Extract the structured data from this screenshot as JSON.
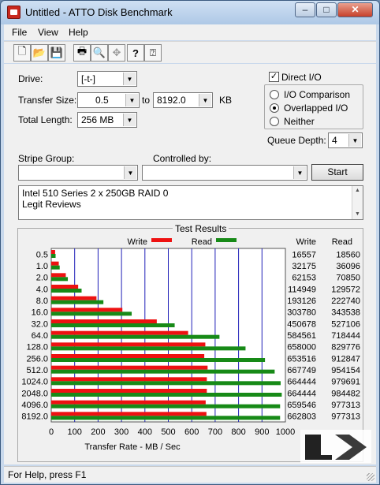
{
  "window": {
    "title": "Untitled - ATTO Disk Benchmark"
  },
  "window_controls": {
    "minimize": "–",
    "maximize": "□",
    "close": "✕"
  },
  "menu": [
    "File",
    "View",
    "Help"
  ],
  "toolbar": {
    "icons": [
      "new-file-icon",
      "open-folder-icon",
      "save-disk-icon",
      "print-icon",
      "print-preview-icon",
      "move-icon",
      "help-icon",
      "context-help-icon"
    ],
    "glyphs": [
      "🗋",
      "📂",
      "💾",
      "🖶",
      "🔍",
      "✥",
      "?",
      "⍰"
    ]
  },
  "settings": {
    "drive_label": "Drive:",
    "drive_value": "[-t-]",
    "transfer_size_label": "Transfer Size:",
    "transfer_from": "0.5",
    "to_label": "to",
    "transfer_to": "8192.0",
    "kb_label": "KB",
    "total_length_label": "Total Length:",
    "total_length_value": "256 MB",
    "direct_io_label": "Direct I/O",
    "direct_io_checked": "✓",
    "io_comparison_label": "I/O Comparison",
    "overlapped_io_label": "Overlapped I/O",
    "neither_label": "Neither",
    "queue_depth_label": "Queue Depth:",
    "queue_depth_value": "4",
    "stripe_group_label": "Stripe Group:",
    "stripe_group_value": "",
    "controlled_by_label": "Controlled by:",
    "controlled_by_value": "",
    "start_button": "Start"
  },
  "description": [
    "Intel 510 Series 2 x 250GB RAID 0",
    "Legit Reviews"
  ],
  "status_bar": "For Help, press F1",
  "colors": {
    "write": "#ee1111",
    "read": "#178a17",
    "grid": "#2020b8"
  },
  "chart_data": {
    "type": "bar",
    "title": "Test Results",
    "xlabel": "Transfer Rate - MB / Sec",
    "categories": [
      "0.5",
      "1.0",
      "2.0",
      "4.0",
      "8.0",
      "16.0",
      "32.0",
      "64.0",
      "128.0",
      "256.0",
      "512.0",
      "1024.0",
      "2048.0",
      "4096.0",
      "8192.0"
    ],
    "series": [
      {
        "name": "Write",
        "values": [
          16557,
          32175,
          62153,
          114949,
          193126,
          303780,
          450678,
          584561,
          658000,
          653516,
          667749,
          664444,
          664444,
          659546,
          662803
        ]
      },
      {
        "name": "Read",
        "values": [
          18560,
          36096,
          70850,
          129572,
          222740,
          343538,
          527106,
          718444,
          829776,
          912847,
          954154,
          979691,
          984482,
          977313,
          977313
        ]
      }
    ],
    "value_columns": [
      "Write",
      "Read"
    ],
    "xticks": [
      "0",
      "100",
      "200",
      "300",
      "400",
      "500",
      "600",
      "700",
      "800",
      "900",
      "1000"
    ],
    "xlim": [
      0,
      1000
    ],
    "legend": "top"
  }
}
